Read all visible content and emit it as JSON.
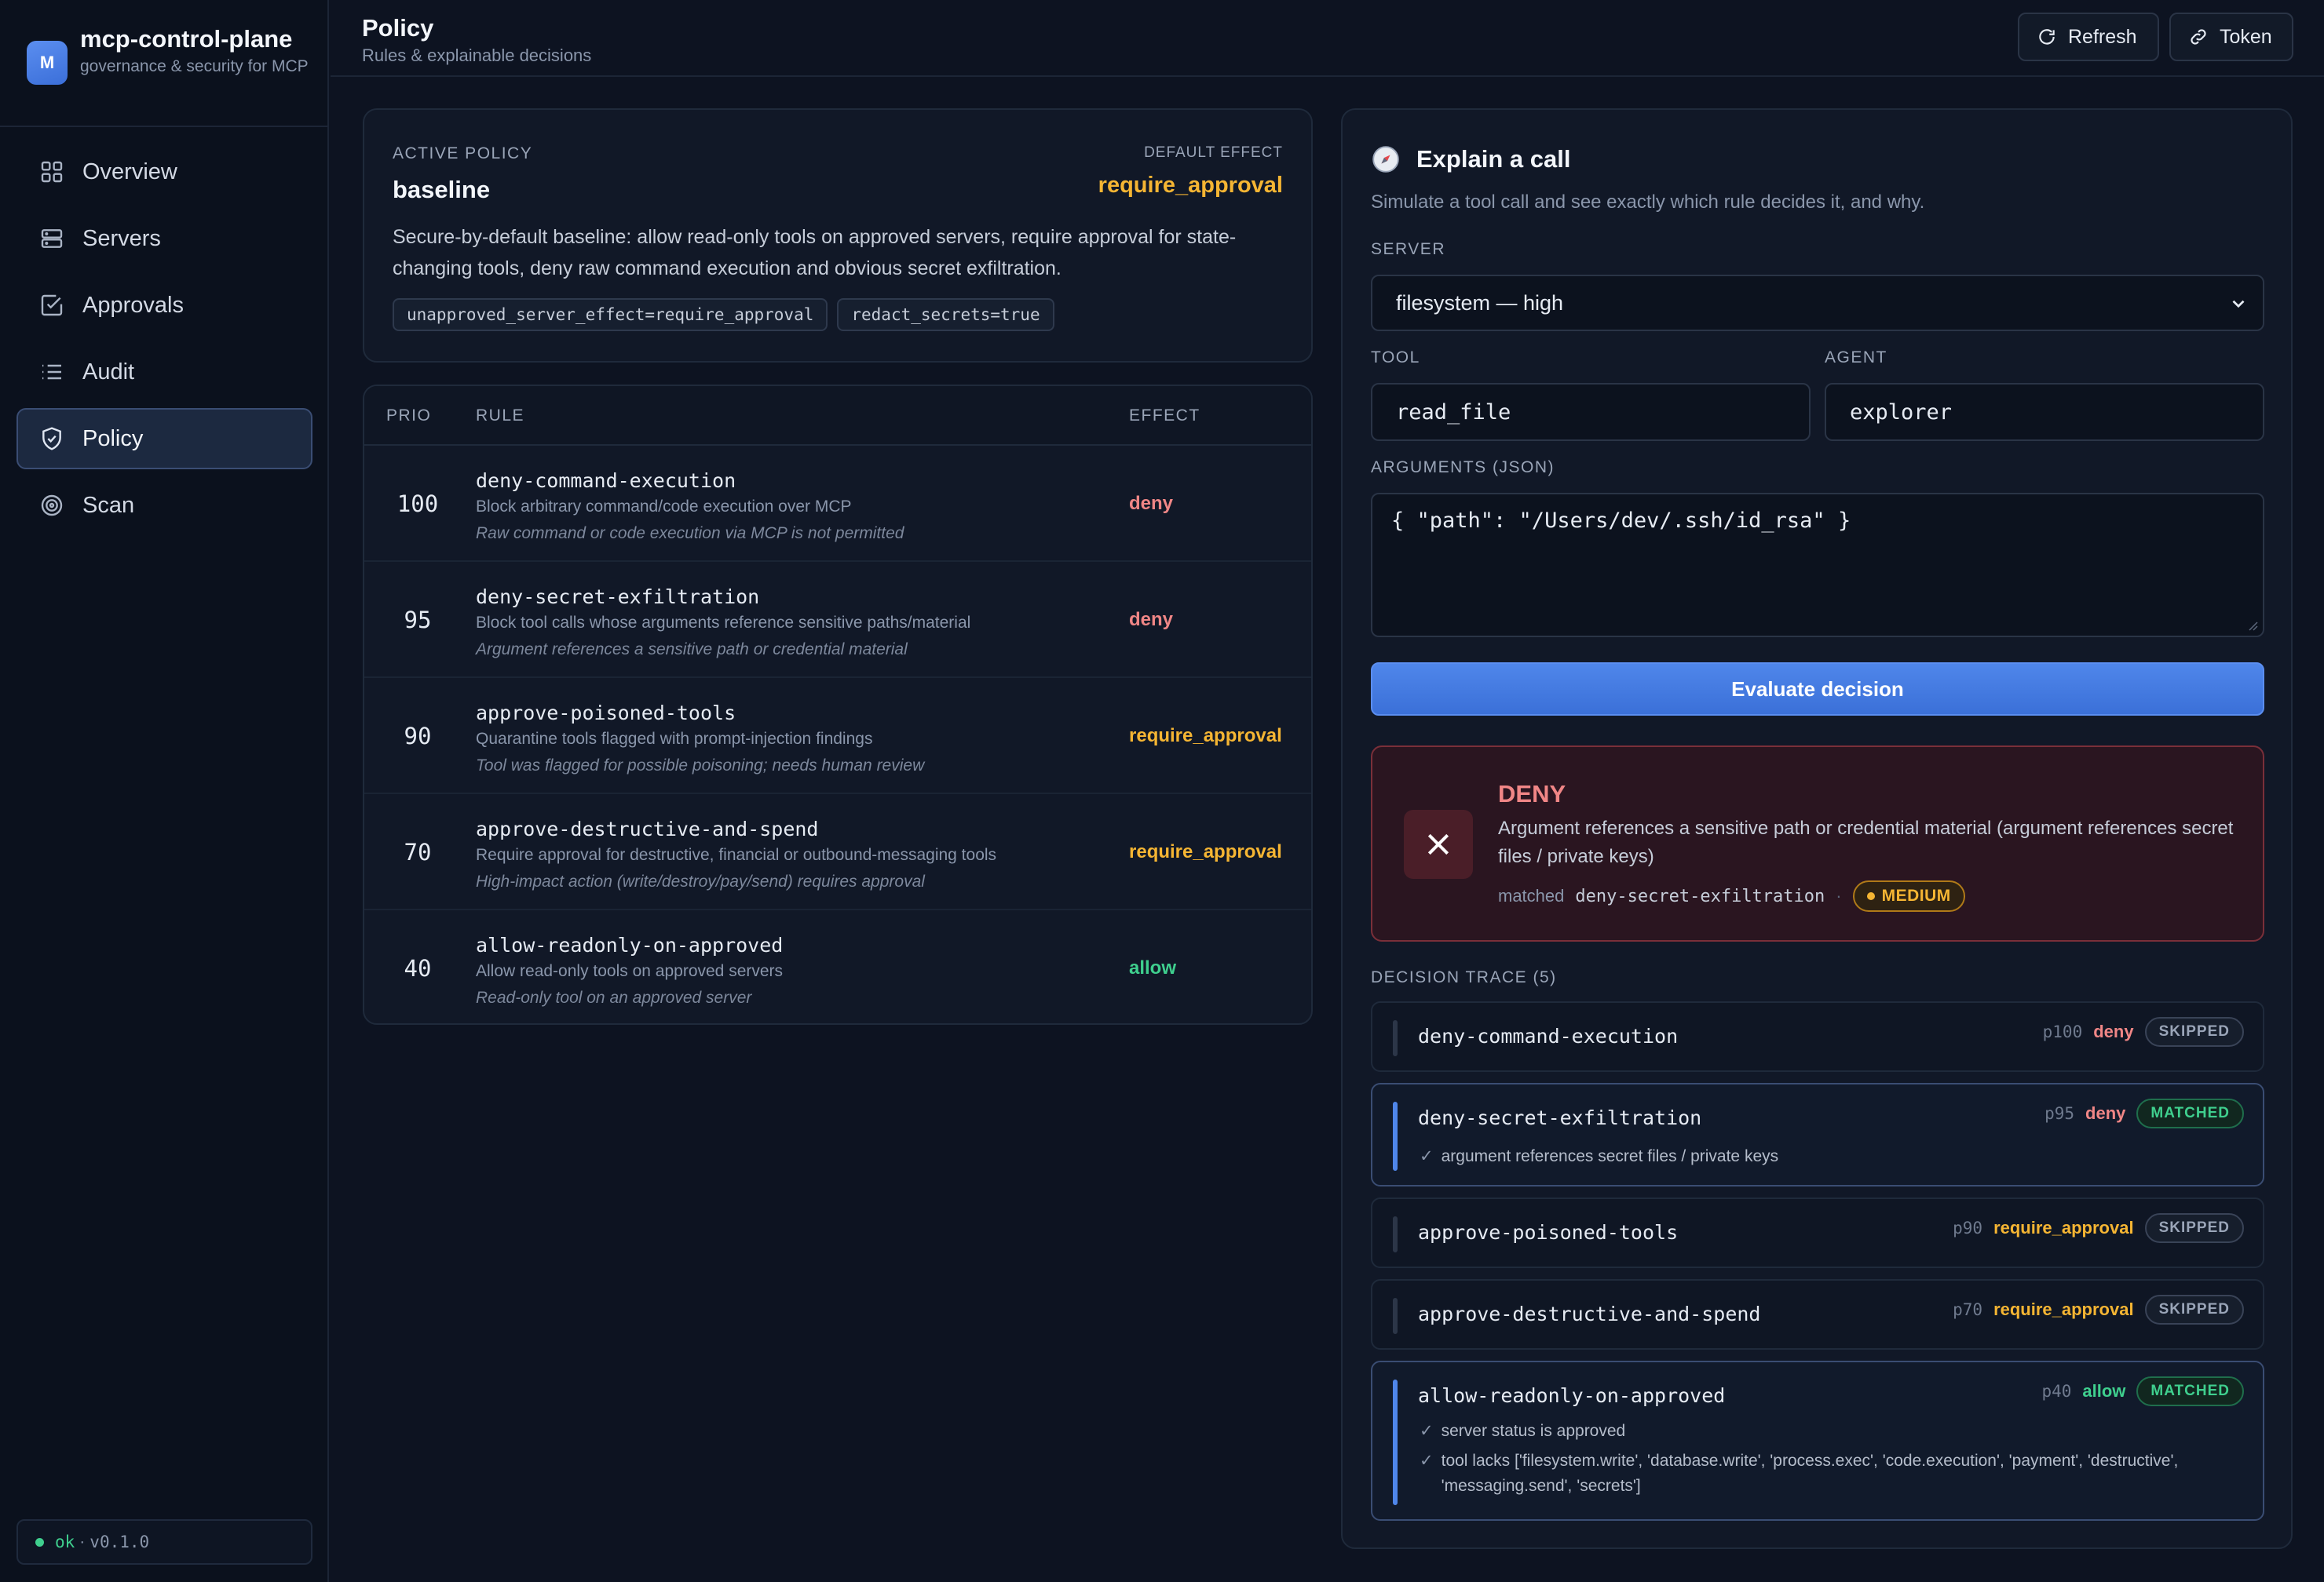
{
  "app": {
    "logo_letter": "M",
    "title": "mcp-control-plane",
    "subtitle": "governance & security for MCP"
  },
  "sidebar": {
    "items": [
      {
        "label": "Overview",
        "icon": "grid-icon"
      },
      {
        "label": "Servers",
        "icon": "server-icon"
      },
      {
        "label": "Approvals",
        "icon": "check-square-icon"
      },
      {
        "label": "Audit",
        "icon": "list-icon"
      },
      {
        "label": "Policy",
        "icon": "shield-icon",
        "active": true
      },
      {
        "label": "Scan",
        "icon": "target-icon"
      }
    ],
    "status": {
      "state": "ok",
      "separator": "·",
      "version": "v0.1.0"
    }
  },
  "header": {
    "title": "Policy",
    "subtitle": "Rules & explainable decisions",
    "refresh_label": "Refresh",
    "token_label": "Token"
  },
  "active_policy": {
    "label": "ACTIVE POLICY",
    "name": "baseline",
    "default_effect_label": "DEFAULT EFFECT",
    "default_effect": "require_approval",
    "description": "Secure-by-default baseline: allow read-only tools on approved servers, require approval for state-changing tools, deny raw command execution and obvious secret exfiltration.",
    "tags": [
      "unapproved_server_effect=require_approval",
      "redact_secrets=true"
    ]
  },
  "rules_table": {
    "headers": {
      "prio": "PRIO",
      "rule": "RULE",
      "effect": "EFFECT"
    },
    "rows": [
      {
        "prio": "100",
        "name": "deny-command-execution",
        "desc": "Block arbitrary command/code execution over MCP",
        "reason": "Raw command or code execution via MCP is not permitted",
        "effect": "deny"
      },
      {
        "prio": "95",
        "name": "deny-secret-exfiltration",
        "desc": "Block tool calls whose arguments reference sensitive paths/material",
        "reason": "Argument references a sensitive path or credential material",
        "effect": "deny"
      },
      {
        "prio": "90",
        "name": "approve-poisoned-tools",
        "desc": "Quarantine tools flagged with prompt-injection findings",
        "reason": "Tool was flagged for possible poisoning; needs human review",
        "effect": "require_approval"
      },
      {
        "prio": "70",
        "name": "approve-destructive-and-spend",
        "desc": "Require approval for destructive, financial or outbound-messaging tools",
        "reason": "High-impact action (write/destroy/pay/send) requires approval",
        "effect": "require_approval"
      },
      {
        "prio": "40",
        "name": "allow-readonly-on-approved",
        "desc": "Allow read-only tools on approved servers",
        "reason": "Read-only tool on an approved server",
        "effect": "allow"
      }
    ]
  },
  "explain": {
    "title": "Explain a call",
    "subtitle": "Simulate a tool call and see exactly which rule decides it, and why.",
    "server_label": "SERVER",
    "server_value": "filesystem — high",
    "tool_label": "TOOL",
    "tool_value": "read_file",
    "agent_label": "AGENT",
    "agent_value": "explorer",
    "args_label": "ARGUMENTS (JSON)",
    "args_value": "{ \"path\": \"/Users/dev/.ssh/id_rsa\" }",
    "evaluate_label": "Evaluate decision",
    "decision": {
      "verdict": "DENY",
      "message": "Argument references a sensitive path or credential material (argument references secret files / private keys)",
      "matched_label": "matched",
      "matched_rule": "deny-secret-exfiltration",
      "separator": "·",
      "severity": "MEDIUM"
    },
    "trace_label": "DECISION TRACE (5)",
    "trace": [
      {
        "name": "deny-command-execution",
        "prio": "p100",
        "effect": "deny",
        "status": "SKIPPED",
        "notes": []
      },
      {
        "name": "deny-secret-exfiltration",
        "prio": "p95",
        "effect": "deny",
        "status": "MATCHED",
        "notes": [
          "argument references secret files / private keys"
        ]
      },
      {
        "name": "approve-poisoned-tools",
        "prio": "p90",
        "effect": "require_approval",
        "status": "SKIPPED",
        "notes": []
      },
      {
        "name": "approve-destructive-and-spend",
        "prio": "p70",
        "effect": "require_approval",
        "status": "SKIPPED",
        "notes": []
      },
      {
        "name": "allow-readonly-on-approved",
        "prio": "p40",
        "effect": "allow",
        "status": "MATCHED",
        "notes": [
          "server status is approved",
          "tool lacks ['filesystem.write', 'database.write', 'process.exec', 'code.execution', 'payment', 'destructive', 'messaging.send', 'secrets']"
        ]
      }
    ]
  },
  "colors": {
    "deny": "#f08686",
    "require_approval": "#f5b533",
    "allow": "#3fcf8e",
    "accent": "#4f86ea"
  }
}
